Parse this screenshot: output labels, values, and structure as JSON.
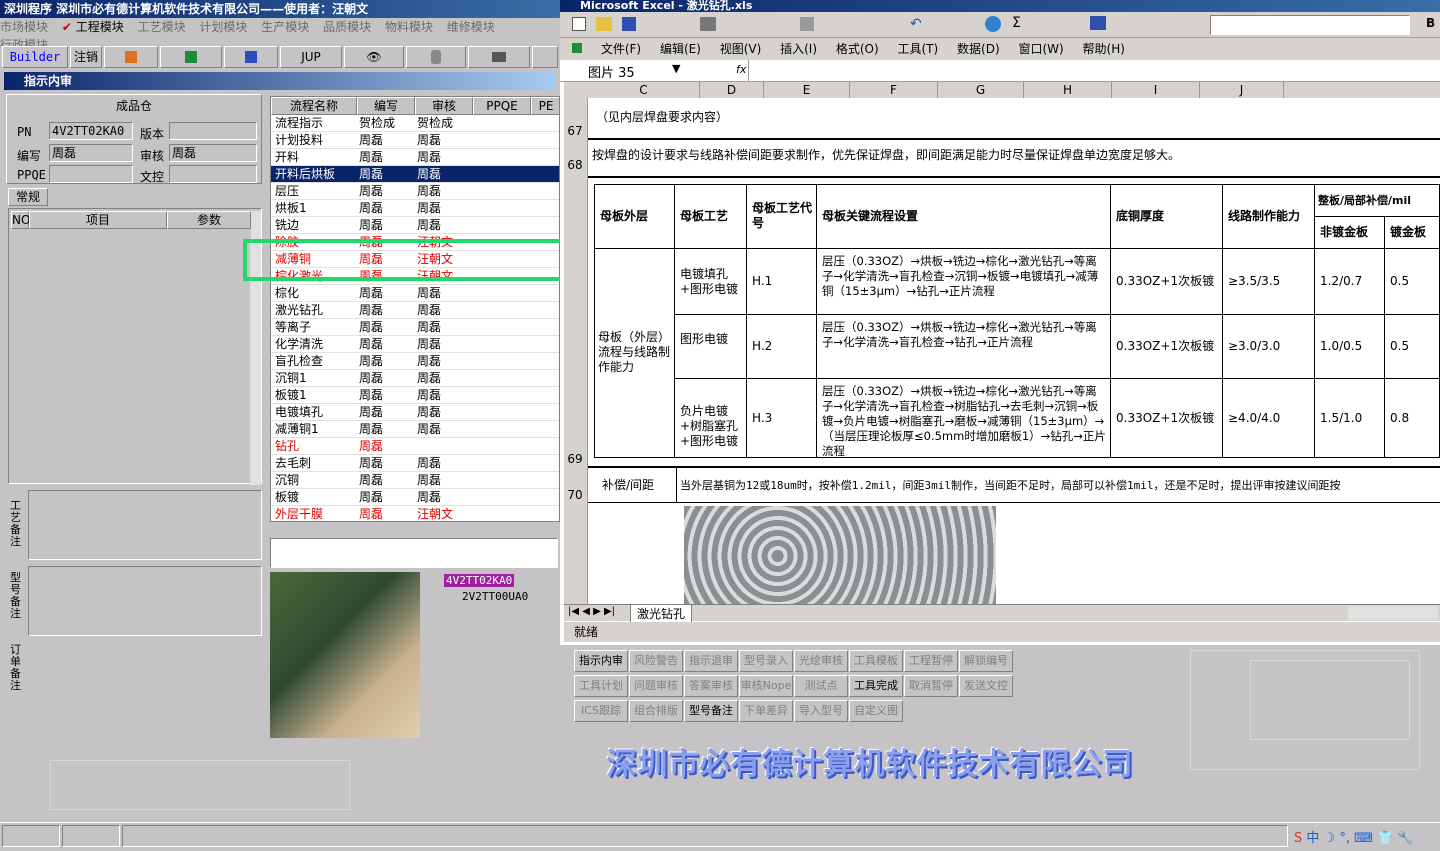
{
  "app": {
    "title": "深圳程序   深圳市必有德计算机软件技术有限公司——使用者：汪朝文",
    "menu": [
      "市场模块",
      "✔ 工程模块",
      "工艺模块",
      "计划模块",
      "生产模块",
      "品质模块",
      "物料模块",
      "维修模块",
      "行政模块"
    ],
    "toolbar": {
      "builder": "Builder",
      "logout": "注销",
      "jup": "JUP"
    },
    "section_title": "指示内审",
    "product_group": "成品仓",
    "fields": {
      "pn_label": "PN",
      "pn_value": "4V2TT02KA0",
      "version_label": "版本",
      "version_value": "",
      "writer_label": "编写",
      "writer_value": "周磊",
      "reviewer_label": "审核",
      "reviewer_value": "周磊",
      "ppqe_label": "PPQE",
      "ppqe_value": "",
      "wenkong_label": "文控",
      "wenkong_value": ""
    },
    "tab_general": "常规",
    "param_headers": [
      "NO",
      "项目",
      "参数"
    ],
    "side_labels": [
      "工艺备注",
      "型号备注",
      "订单备注"
    ],
    "flow_headers": [
      "流程名称",
      "编写",
      "审核",
      "PPQE",
      "PE"
    ],
    "flow_rows": [
      {
        "name": "流程指示",
        "writer": "贺检成",
        "reviewer": "贺检成",
        "red": false,
        "sel": false
      },
      {
        "name": "计划投料",
        "writer": "周磊",
        "reviewer": "周磊",
        "red": false,
        "sel": false
      },
      {
        "name": "开料",
        "writer": "周磊",
        "reviewer": "周磊",
        "red": false,
        "sel": false
      },
      {
        "name": "开料后烘板",
        "writer": "周磊",
        "reviewer": "周磊",
        "red": false,
        "sel": true
      },
      {
        "name": "层压",
        "writer": "周磊",
        "reviewer": "周磊",
        "red": false,
        "sel": false
      },
      {
        "name": "烘板1",
        "writer": "周磊",
        "reviewer": "周磊",
        "red": false,
        "sel": false
      },
      {
        "name": "铣边",
        "writer": "周磊",
        "reviewer": "周磊",
        "red": false,
        "sel": false
      },
      {
        "name": "除胶",
        "writer": "周磊",
        "reviewer": "汪朝文",
        "red": true,
        "sel": false
      },
      {
        "name": "减薄铜",
        "writer": "周磊",
        "reviewer": "汪朝文",
        "red": true,
        "sel": false
      },
      {
        "name": "棕化激光",
        "writer": "周磊",
        "reviewer": "汪朝文",
        "red": true,
        "sel": false
      },
      {
        "name": "棕化",
        "writer": "周磊",
        "reviewer": "周磊",
        "red": false,
        "sel": false
      },
      {
        "name": "激光钻孔",
        "writer": "周磊",
        "reviewer": "周磊",
        "red": false,
        "sel": false
      },
      {
        "name": "等离子",
        "writer": "周磊",
        "reviewer": "周磊",
        "red": false,
        "sel": false
      },
      {
        "name": "化学清洗",
        "writer": "周磊",
        "reviewer": "周磊",
        "red": false,
        "sel": false
      },
      {
        "name": "盲孔检查",
        "writer": "周磊",
        "reviewer": "周磊",
        "red": false,
        "sel": false
      },
      {
        "name": "沉铜1",
        "writer": "周磊",
        "reviewer": "周磊",
        "red": false,
        "sel": false
      },
      {
        "name": "板镀1",
        "writer": "周磊",
        "reviewer": "周磊",
        "red": false,
        "sel": false
      },
      {
        "name": "电镀填孔",
        "writer": "周磊",
        "reviewer": "周磊",
        "red": false,
        "sel": false
      },
      {
        "name": "减薄铜1",
        "writer": "周磊",
        "reviewer": "周磊",
        "red": false,
        "sel": false
      },
      {
        "name": "钻孔",
        "writer": "周磊",
        "reviewer": "",
        "red": true,
        "sel": false
      },
      {
        "name": "去毛刺",
        "writer": "周磊",
        "reviewer": "周磊",
        "red": false,
        "sel": false
      },
      {
        "name": "沉铜",
        "writer": "周磊",
        "reviewer": "周磊",
        "red": false,
        "sel": false
      },
      {
        "name": "板镀",
        "writer": "周磊",
        "reviewer": "周磊",
        "red": false,
        "sel": false
      },
      {
        "name": "外层干膜",
        "writer": "周磊",
        "reviewer": "汪朝文",
        "red": true,
        "sel": false
      }
    ],
    "tree": {
      "root": "4V2TT02KA0",
      "child": "2V2TT00UA0"
    },
    "buttons": [
      [
        {
          "t": "指示内审",
          "on": true
        },
        {
          "t": "风险警告",
          "on": false
        },
        {
          "t": "指示退审",
          "on": false
        },
        {
          "t": "型号录入",
          "on": false
        },
        {
          "t": "光绘审核",
          "on": false
        },
        {
          "t": "工具模板",
          "on": false
        },
        {
          "t": "工程暂停",
          "on": false
        },
        {
          "t": "解锁编号",
          "on": false
        }
      ],
      [
        {
          "t": "工具计划",
          "on": false
        },
        {
          "t": "问题审核",
          "on": false
        },
        {
          "t": "答案审核",
          "on": false
        },
        {
          "t": "审核Nope",
          "on": false
        },
        {
          "t": "测试点",
          "on": false
        },
        {
          "t": "工具完成",
          "on": true
        },
        {
          "t": "取消暂停",
          "on": false
        },
        {
          "t": "发送文控",
          "on": false
        }
      ],
      [
        {
          "t": "ICS跟踪",
          "on": false
        },
        {
          "t": "组合排版",
          "on": false
        },
        {
          "t": "型号备注",
          "on": true
        },
        {
          "t": "下单差异",
          "on": false
        },
        {
          "t": "导入型号",
          "on": false
        },
        {
          "t": "自定义图",
          "on": false
        }
      ]
    ],
    "banner": "深圳市必有德计算机软件技术有限公司"
  },
  "excel": {
    "title": "Microsoft Excel - 激光钻孔.xls",
    "menu": [
      "文件(F)",
      "编辑(E)",
      "视图(V)",
      "插入(I)",
      "格式(O)",
      "工具(T)",
      "数据(D)",
      "窗口(W)",
      "帮助(H)"
    ],
    "name_box": "图片 35",
    "fx": "fx",
    "cols": [
      "C",
      "D",
      "E",
      "F",
      "G",
      "H",
      "I",
      "J"
    ],
    "rows": [
      "67",
      "68",
      "69",
      "70"
    ],
    "r67": "（见内层焊盘要求内容）",
    "r68": "按焊盘的设计要求与线路补偿间距要求制作，优先保证焊盘，即间距满足能力时尽量保证焊盘单边宽度足够大。",
    "th": {
      "h1": "母板外层",
      "h2": "母板工艺",
      "h3": "母板工艺代号",
      "h4": "母板关键流程设置",
      "h5": "底铜厚度",
      "h6": "线路制作能力",
      "h7": "整板/局部补偿/mil",
      "h7a": "非镀金板",
      "h7b": "镀金板"
    },
    "group": "母板（外层）流程与线路制作能力",
    "r": [
      {
        "proc": "电镀填孔+图形电镀",
        "code": "H.1",
        "flow": "层压（0.33OZ）→烘板→铣边→棕化→激光钻孔→等离子→化学清洗→盲孔检查→沉铜→板镀→电镀填孔→减薄铜（15±3μm）→钻孔→正片流程",
        "cu": "0.33OZ+1次板镀",
        "cap": "≥3.5/3.5",
        "nongold": "1.2/0.7",
        "gold": "0.5"
      },
      {
        "proc": "图形电镀",
        "code": "H.2",
        "flow": "层压（0.33OZ）→烘板→铣边→棕化→激光钻孔→等离子→化学清洗→盲孔检查→钻孔→正片流程",
        "cu": "0.33OZ+1次板镀",
        "cap": "≥3.0/3.0",
        "nongold": "1.0/0.5",
        "gold": "0.5"
      },
      {
        "proc": "负片电镀+树脂塞孔+图形电镀",
        "code": "H.3",
        "flow": "层压（0.33OZ）→烘板→铣边→棕化→激光钻孔→等离子→化学清洗→盲孔检查→树脂钻孔→去毛刺→沉铜→板镀→负片电镀→树脂塞孔→磨板→减薄铜（15±3μm）→（当层压理论板厚≤0.5mm时增加磨板1）→钻孔→正片流程",
        "cu": "0.33OZ+1次板镀",
        "cap": "≥4.0/4.0",
        "nongold": "1.5/1.0",
        "gold": "0.8"
      }
    ],
    "r70a": "补偿/间距",
    "r70b": "当外层基铜为12或18um时，按补偿1.2mil，间距3mil制作，当间距不足时，局部可以补偿1mil，还是不足时，提出评审按建议间距按",
    "sheet_tab": "激光钻孔",
    "status": "就绪"
  }
}
